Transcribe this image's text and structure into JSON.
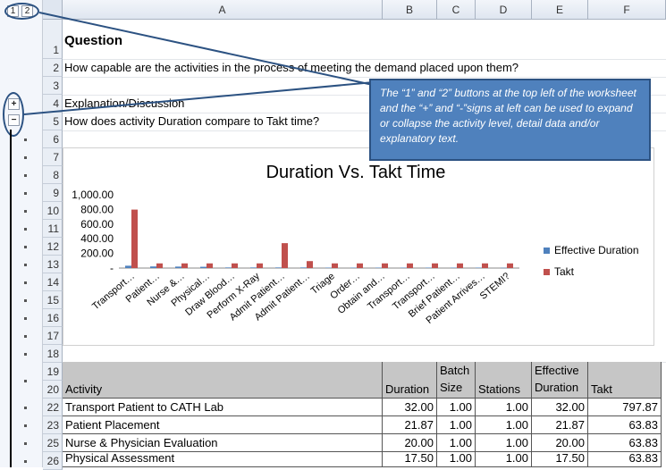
{
  "outline": {
    "level_buttons": [
      "1",
      "2"
    ],
    "expand_symbol": "+",
    "collapse_symbol": "−"
  },
  "columns": [
    "A",
    "B",
    "C",
    "D",
    "E",
    "F"
  ],
  "rows": {
    "r1": "1",
    "r2": "2",
    "r3": "3",
    "r4": "4",
    "r5": "5",
    "r6": "6",
    "r7": "7",
    "r8": "8",
    "r9": "9",
    "r10": "10",
    "r11": "11",
    "r12": "12",
    "r13": "13",
    "r14": "14",
    "r15": "15",
    "r16": "16",
    "r17": "17",
    "r18": "18",
    "r19": "19",
    "r20": "20",
    "r22": "22",
    "r23": "23",
    "r25": "25",
    "r26": "26"
  },
  "sheet": {
    "question_heading": "Question",
    "question_text": "How capable are the activities in the process of meeting the demand placed upon them?",
    "explanation_heading": "Explanation/Discussion",
    "explanation_text": "How does activity Duration compare to Takt time?"
  },
  "callout": {
    "text": "The “1” and “2” buttons at the top left of the worksheet and the “+” and “-”signs at left can be used to expand or collapse the activity level, detail data and/or explanatory text."
  },
  "chart_data": {
    "type": "bar",
    "title": "Duration Vs. Takt Time",
    "categories": [
      "Transport…",
      "Patient…",
      "Nurse &…",
      "Physical…",
      "Draw Blood…",
      "Perform X-Ray",
      "Admit Patient…",
      "Admit Patient…",
      "Triage",
      "Order…",
      "Obtain and…",
      "Transport…",
      "Transport…",
      "Brief Patient…",
      "Patient Arrives…",
      "STEMI?"
    ],
    "series": [
      {
        "name": "Effective Duration",
        "color": "#4f81bd",
        "values": [
          32,
          22,
          20,
          17.5,
          8,
          8,
          8,
          8,
          6,
          6,
          6,
          6,
          6,
          6,
          6,
          4
        ]
      },
      {
        "name": "Takt",
        "color": "#c0504d",
        "values": [
          797.87,
          63.83,
          63.83,
          63.83,
          63.83,
          63.83,
          340,
          95,
          63.83,
          63.83,
          63.83,
          63.83,
          63.83,
          63.83,
          63.83,
          63.83
        ]
      }
    ],
    "yticks": [
      "1,000.00",
      "800.00",
      "600.00",
      "400.00",
      "200.00",
      "-"
    ],
    "ylim": [
      0,
      1000
    ],
    "legend": "right",
    "grid": false
  },
  "table": {
    "headers": {
      "activity": "Activity",
      "duration": "Duration",
      "batch": [
        "Batch",
        "Size"
      ],
      "stations": "Stations",
      "effective": [
        "Effective",
        "Duration"
      ],
      "takt": "Takt"
    },
    "rows": [
      {
        "activity": "Transport Patient to CATH Lab",
        "duration": "32.00",
        "batch": "1.00",
        "stations": "1.00",
        "effective": "32.00",
        "takt": "797.87"
      },
      {
        "activity": "Patient Placement",
        "duration": "21.87",
        "batch": "1.00",
        "stations": "1.00",
        "effective": "21.87",
        "takt": "63.83"
      },
      {
        "activity": "Nurse & Physician Evaluation",
        "duration": "20.00",
        "batch": "1.00",
        "stations": "1.00",
        "effective": "20.00",
        "takt": "63.83"
      },
      {
        "activity": "Physical Assessment",
        "duration": "17.50",
        "batch": "1.00",
        "stations": "1.00",
        "effective": "17.50",
        "takt": "63.83"
      }
    ]
  }
}
